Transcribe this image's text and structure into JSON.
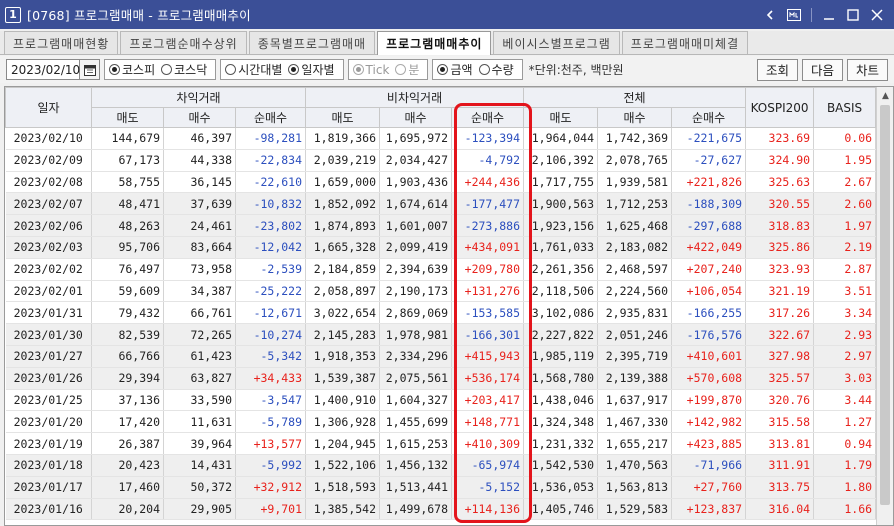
{
  "window": {
    "number": "1",
    "title": "[0768] 프로그램매매 - 프로그램매매추이",
    "ctrl_icons": [
      "back-icon",
      "layout-icon",
      "minimize-icon",
      "maximize-icon",
      "close-icon"
    ]
  },
  "tabs": [
    {
      "label": "프로그램매매현황",
      "active": false
    },
    {
      "label": "프로그램순매수상위",
      "active": false
    },
    {
      "label": "종목별프로그램매매",
      "active": false
    },
    {
      "label": "프로그램매매추이",
      "active": true
    },
    {
      "label": "베이시스별프로그램",
      "active": false
    },
    {
      "label": "프로그램매매미체결",
      "active": false
    }
  ],
  "toolbar": {
    "date": "2023/02/10",
    "market": {
      "kospi": "코스피",
      "kosdaq": "코스닥",
      "selected": "kospi"
    },
    "period": {
      "hourly": "시간대별",
      "daily": "일자별",
      "selected": "daily"
    },
    "tick": {
      "tick": "Tick",
      "minute": "분",
      "selected": "tick"
    },
    "measure": {
      "amount": "금액",
      "quantity": "수량",
      "selected": "amount"
    },
    "unit_note": "*단위:천주, 백만원",
    "btn_query": "조회",
    "btn_next": "다음",
    "btn_chart": "차트"
  },
  "table": {
    "groups": {
      "date": "일자",
      "arbitrage": "차익거래",
      "nonarbitrage": "비차익거래",
      "total": "전체",
      "kospi": "KOSPI200",
      "basis": "BASIS"
    },
    "sub": {
      "sell": "매도",
      "buy": "매수",
      "net": "순매수"
    },
    "rows": [
      [
        "2023/02/10",
        "144,679",
        "46,397",
        "-98,281",
        "1,819,366",
        "1,695,972",
        "-123,394",
        "1,964,044",
        "1,742,369",
        "-221,675",
        "323.69",
        "0.06"
      ],
      [
        "2023/02/09",
        "67,173",
        "44,338",
        "-22,834",
        "2,039,219",
        "2,034,427",
        "-4,792",
        "2,106,392",
        "2,078,765",
        "-27,627",
        "324.90",
        "1.95"
      ],
      [
        "2023/02/08",
        "58,755",
        "36,145",
        "-22,610",
        "1,659,000",
        "1,903,436",
        "+244,436",
        "1,717,755",
        "1,939,581",
        "+221,826",
        "325.63",
        "2.67"
      ],
      [
        "2023/02/07",
        "48,471",
        "37,639",
        "-10,832",
        "1,852,092",
        "1,674,614",
        "-177,477",
        "1,900,563",
        "1,712,253",
        "-188,309",
        "320.55",
        "2.60"
      ],
      [
        "2023/02/06",
        "48,263",
        "24,461",
        "-23,802",
        "1,874,893",
        "1,601,007",
        "-273,886",
        "1,923,156",
        "1,625,468",
        "-297,688",
        "318.83",
        "1.97"
      ],
      [
        "2023/02/03",
        "95,706",
        "83,664",
        "-12,042",
        "1,665,328",
        "2,099,419",
        "+434,091",
        "1,761,033",
        "2,183,082",
        "+422,049",
        "325.86",
        "2.19"
      ],
      [
        "2023/02/02",
        "76,497",
        "73,958",
        "-2,539",
        "2,184,859",
        "2,394,639",
        "+209,780",
        "2,261,356",
        "2,468,597",
        "+207,240",
        "323.93",
        "2.87"
      ],
      [
        "2023/02/01",
        "59,609",
        "34,387",
        "-25,222",
        "2,058,897",
        "2,190,173",
        "+131,276",
        "2,118,506",
        "2,224,560",
        "+106,054",
        "321.19",
        "3.51"
      ],
      [
        "2023/01/31",
        "79,432",
        "66,761",
        "-12,671",
        "3,022,654",
        "2,869,069",
        "-153,585",
        "3,102,086",
        "2,935,831",
        "-166,255",
        "317.26",
        "3.34"
      ],
      [
        "2023/01/30",
        "82,539",
        "72,265",
        "-10,274",
        "2,145,283",
        "1,978,981",
        "-166,301",
        "2,227,822",
        "2,051,246",
        "-176,576",
        "322.67",
        "2.93"
      ],
      [
        "2023/01/27",
        "66,766",
        "61,423",
        "-5,342",
        "1,918,353",
        "2,334,296",
        "+415,943",
        "1,985,119",
        "2,395,719",
        "+410,601",
        "327.98",
        "2.97"
      ],
      [
        "2023/01/26",
        "29,394",
        "63,827",
        "+34,433",
        "1,539,387",
        "2,075,561",
        "+536,174",
        "1,568,780",
        "2,139,388",
        "+570,608",
        "325.57",
        "3.03"
      ],
      [
        "2023/01/25",
        "37,136",
        "33,590",
        "-3,547",
        "1,400,910",
        "1,604,327",
        "+203,417",
        "1,438,046",
        "1,637,917",
        "+199,870",
        "320.76",
        "3.44"
      ],
      [
        "2023/01/20",
        "17,420",
        "11,631",
        "-5,789",
        "1,306,928",
        "1,455,699",
        "+148,771",
        "1,324,348",
        "1,467,330",
        "+142,982",
        "315.58",
        "1.27"
      ],
      [
        "2023/01/19",
        "26,387",
        "39,964",
        "+13,577",
        "1,204,945",
        "1,615,253",
        "+410,309",
        "1,231,332",
        "1,655,217",
        "+423,885",
        "313.81",
        "0.94"
      ],
      [
        "2023/01/18",
        "20,423",
        "14,431",
        "-5,992",
        "1,522,106",
        "1,456,132",
        "-65,974",
        "1,542,530",
        "1,470,563",
        "-71,966",
        "311.91",
        "1.79"
      ],
      [
        "2023/01/17",
        "17,460",
        "50,372",
        "+32,912",
        "1,518,593",
        "1,513,441",
        "-5,152",
        "1,536,053",
        "1,563,813",
        "+27,760",
        "313.75",
        "1.80"
      ],
      [
        "2023/01/16",
        "20,204",
        "29,905",
        "+9,701",
        "1,385,542",
        "1,499,678",
        "+114,136",
        "1,405,746",
        "1,529,583",
        "+123,837",
        "316.04",
        "1.66"
      ]
    ]
  },
  "colors": {
    "titlebar": "#3b4f97",
    "positive": "#e8221c",
    "negative": "#2c4fbe",
    "highlight": "#e3141b"
  }
}
